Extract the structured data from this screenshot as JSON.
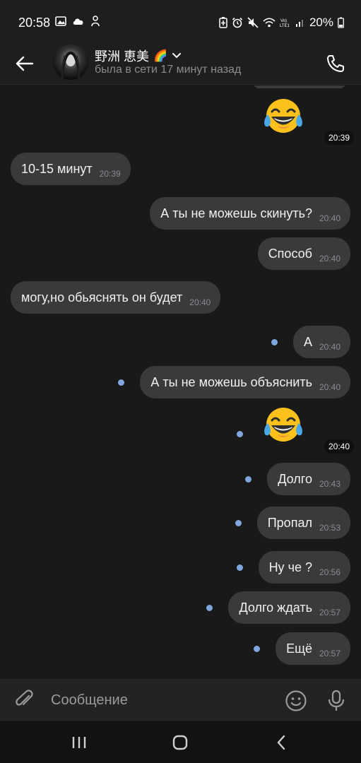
{
  "status_bar": {
    "time": "20:58",
    "battery": "20%",
    "left_icons": [
      "gallery-icon",
      "cloud-icon",
      "notification-app-icon"
    ],
    "right_icons": [
      "battery-saver-icon",
      "alarm-icon",
      "mute-icon",
      "wifi-icon",
      "volte-icon",
      "signal-icon",
      "battery-icon"
    ]
  },
  "header": {
    "name": "野洲 恵美",
    "name_emoji": "🌈",
    "status": "была в сети 17 минут назад"
  },
  "messages": [
    {
      "type": "emoji",
      "side": "out",
      "emoji": "😂",
      "time": "20:39"
    },
    {
      "type": "text",
      "side": "in",
      "text": "10-15 минут",
      "time": "20:39"
    },
    {
      "type": "text",
      "side": "out",
      "text": "А ты не можешь скинуть?",
      "time": "20:40"
    },
    {
      "type": "text",
      "side": "out",
      "text": "Способ",
      "time": "20:40"
    },
    {
      "type": "text",
      "side": "in",
      "text": "могу,но обьяснять он будет",
      "time": "20:40"
    },
    {
      "type": "text",
      "side": "out",
      "text": "А",
      "time": "20:40",
      "unread": true
    },
    {
      "type": "text",
      "side": "out",
      "text": "А ты не можешь объяснить",
      "time": "20:40",
      "unread": true
    },
    {
      "type": "emoji",
      "side": "out",
      "emoji": "😂",
      "time": "20:40",
      "unread": true
    },
    {
      "type": "text",
      "side": "out",
      "text": "Долго",
      "time": "20:43",
      "unread": true
    },
    {
      "type": "text",
      "side": "out",
      "text": "Пропал",
      "time": "20:53",
      "unread": true
    },
    {
      "type": "text",
      "side": "out",
      "text": "Ну че ?",
      "time": "20:56",
      "unread": true
    },
    {
      "type": "text",
      "side": "out",
      "text": "Долго ждать",
      "time": "20:57",
      "unread": true
    },
    {
      "type": "text",
      "side": "out",
      "text": "Ещё",
      "time": "20:57",
      "unread": true
    }
  ],
  "composer": {
    "placeholder": "Сообщение"
  },
  "colors": {
    "background": "#19191a",
    "bubble": "#3a3a3c",
    "unread_dot": "#7fa7dd"
  }
}
